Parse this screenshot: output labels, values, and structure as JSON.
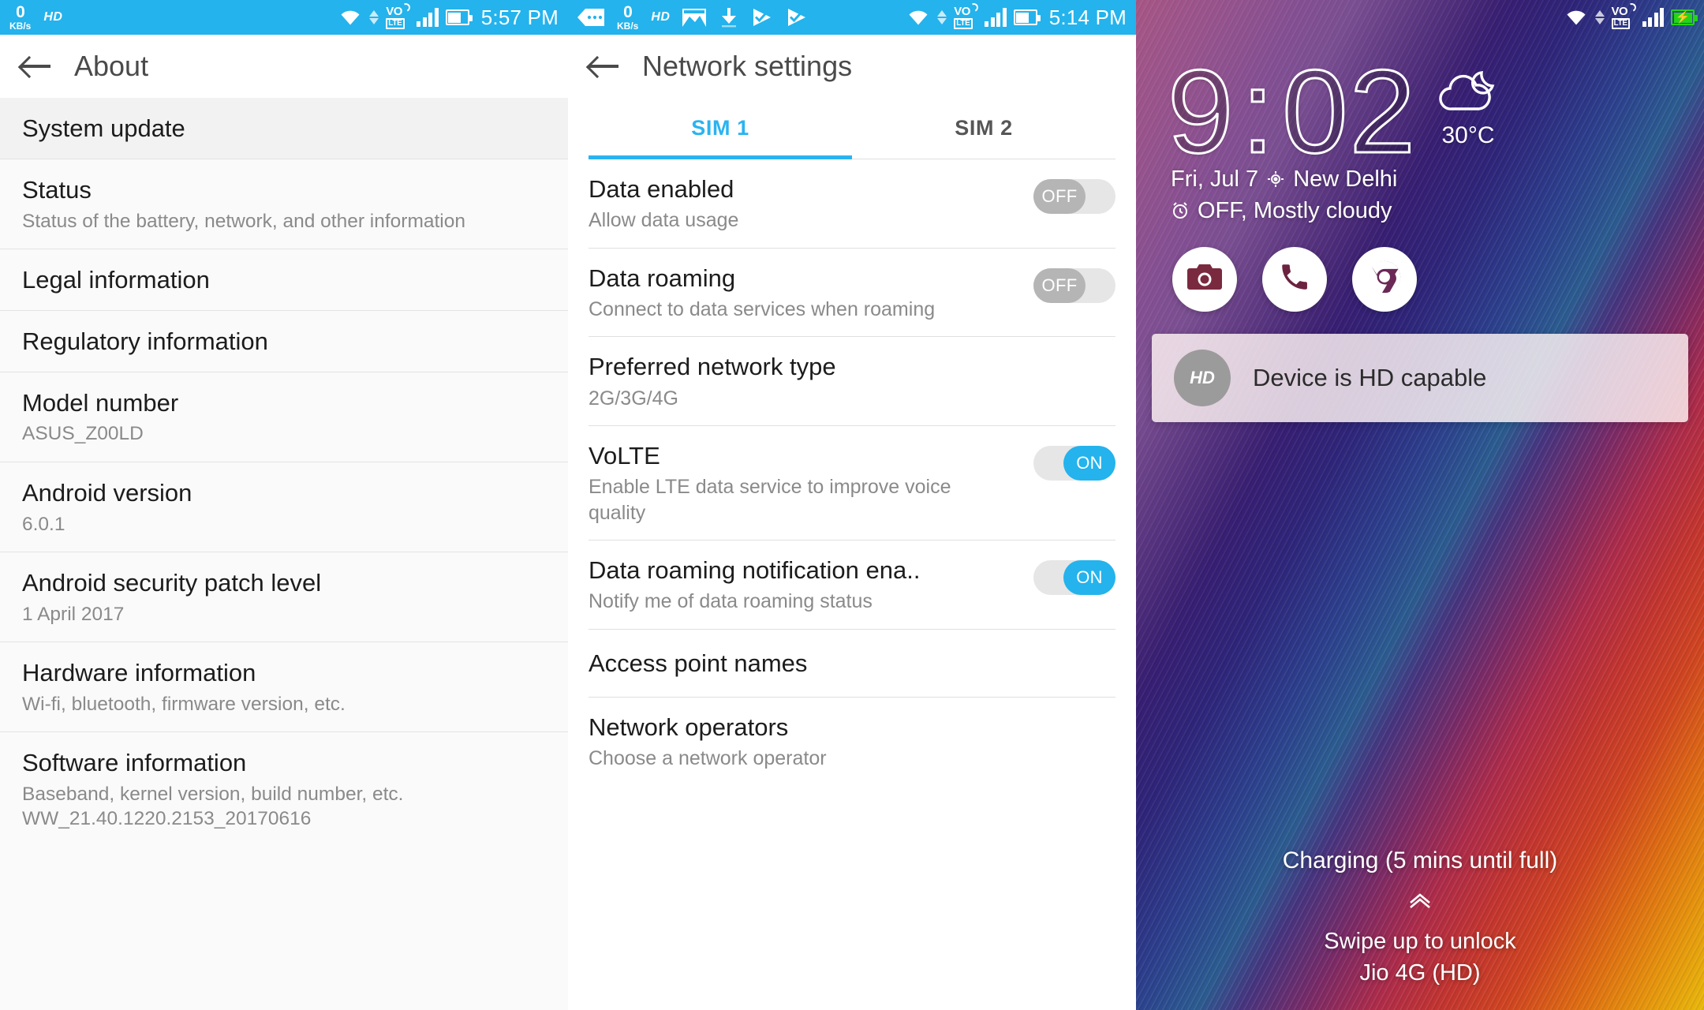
{
  "panels": {
    "about": {
      "statusbar": {
        "data_rate_value": "0",
        "data_rate_unit": "KB/s",
        "hd_badge": "HD",
        "time": "5:57 PM",
        "icons": [
          "wifi-icon",
          "data-transfer-arrows-icon",
          "volte-icon",
          "signal-bars-icon",
          "battery-icon"
        ]
      },
      "appbar": {
        "title": "About",
        "back_label": "Back"
      },
      "items": [
        {
          "title": "System update",
          "sub": "",
          "highlight": true
        },
        {
          "title": "Status",
          "sub": "Status of the battery, network, and other information"
        },
        {
          "title": "Legal information",
          "sub": ""
        },
        {
          "title": "Regulatory information",
          "sub": ""
        },
        {
          "title": "Model number",
          "sub": "ASUS_Z00LD"
        },
        {
          "title": "Android version",
          "sub": "6.0.1"
        },
        {
          "title": "Android security patch level",
          "sub": "1 April 2017"
        },
        {
          "title": "Hardware information",
          "sub": "Wi-fi, bluetooth, firmware version, etc."
        },
        {
          "title": "Software information",
          "sub": "Baseband, kernel version, build number, etc.\nWW_21.40.1220.2153_20170616"
        }
      ]
    },
    "network": {
      "statusbar": {
        "data_rate_value": "0",
        "data_rate_unit": "KB/s",
        "hd_badge": "HD",
        "time": "5:14 PM",
        "icons": [
          "message-icon",
          "image-icon",
          "download-icon",
          "playstore-check-icon",
          "playstore-check-icon",
          "wifi-icon",
          "data-transfer-arrows-icon",
          "volte-icon",
          "signal-bars-icon",
          "battery-icon"
        ]
      },
      "appbar": {
        "title": "Network settings",
        "back_label": "Back"
      },
      "tabs": [
        {
          "label": "SIM 1",
          "active": true
        },
        {
          "label": "SIM 2",
          "active": false
        }
      ],
      "items": [
        {
          "title": "Data enabled",
          "sub": "Allow data usage",
          "toggle": "OFF"
        },
        {
          "title": "Data roaming",
          "sub": "Connect to data services when roaming",
          "toggle": "OFF"
        },
        {
          "title": "Preferred network type",
          "sub": "2G/3G/4G",
          "toggle": null
        },
        {
          "title": "VoLTE",
          "sub": "Enable LTE data service to improve voice quality",
          "toggle": "ON"
        },
        {
          "title": "Data roaming notification ena..",
          "sub": "Notify me of data roaming status",
          "toggle": "ON"
        },
        {
          "title": "Access point names",
          "sub": "",
          "toggle": null
        },
        {
          "title": "Network operators",
          "sub": "Choose a network operator",
          "toggle": null
        }
      ]
    },
    "lock": {
      "statusbar": {
        "time": "",
        "icons": [
          "wifi-icon",
          "data-transfer-arrows-icon",
          "volte-icon",
          "signal-bars-icon",
          "battery-charging-icon"
        ]
      },
      "clock": {
        "hours": "9",
        "separator": ":",
        "minutes": "02"
      },
      "weather": {
        "temp": "30°C",
        "icon": "moon-cloud-icon"
      },
      "date_line": "Fri, Jul 7",
      "location": "New Delhi",
      "alarm_weather_line": "OFF, Mostly cloudy",
      "shortcuts": [
        {
          "name": "camera-shortcut",
          "icon": "camera-icon"
        },
        {
          "name": "phone-shortcut",
          "icon": "phone-icon"
        },
        {
          "name": "chrome-shortcut",
          "icon": "chrome-icon"
        }
      ],
      "notification": {
        "avatar_text": "HD",
        "title": "Device is HD capable"
      },
      "charging_text": "Charging (5 mins until full)",
      "swipe_text": "Swipe up to unlock",
      "carrier_text": "Jio 4G (HD)"
    }
  },
  "colors": {
    "statusbar_blue": "#24b3ec",
    "accent_blue": "#2bb3f0",
    "toggle_on": "#24b3ec",
    "toggle_off_knob": "#b5b5b5",
    "battery_charging_green": "#24d515"
  }
}
